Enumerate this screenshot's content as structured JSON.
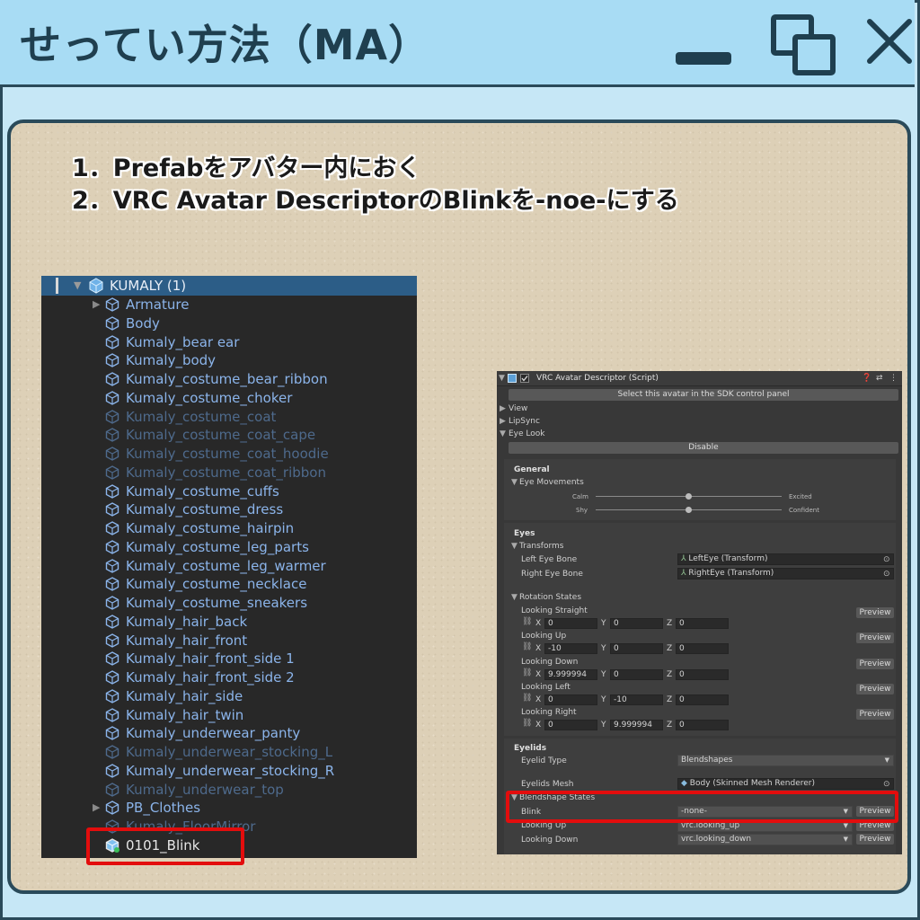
{
  "window": {
    "title": "せってい方法（MA）"
  },
  "steps": [
    "1．Prefabをアバター内におく",
    "2．VRC Avatar DescriptorのBlinkを-noe-にする"
  ],
  "hierarchy": {
    "root": "KUMALY (1)",
    "items": [
      {
        "label": "Armature",
        "state": "on",
        "arrow": true
      },
      {
        "label": "Body",
        "state": "on",
        "arrow": false
      },
      {
        "label": "Kumaly_bear ear",
        "state": "on",
        "arrow": false
      },
      {
        "label": "Kumaly_body",
        "state": "on",
        "arrow": false
      },
      {
        "label": "Kumaly_costume_bear_ribbon",
        "state": "on",
        "arrow": false
      },
      {
        "label": "Kumaly_costume_choker",
        "state": "on",
        "arrow": false
      },
      {
        "label": "Kumaly_costume_coat",
        "state": "off",
        "arrow": false
      },
      {
        "label": "Kumaly_costume_coat_cape",
        "state": "off",
        "arrow": false
      },
      {
        "label": "Kumaly_costume_coat_hoodie",
        "state": "off",
        "arrow": false
      },
      {
        "label": "Kumaly_costume_coat_ribbon",
        "state": "off",
        "arrow": false
      },
      {
        "label": "Kumaly_costume_cuffs",
        "state": "on",
        "arrow": false
      },
      {
        "label": "Kumaly_costume_dress",
        "state": "on",
        "arrow": false
      },
      {
        "label": "Kumaly_costume_hairpin",
        "state": "on",
        "arrow": false
      },
      {
        "label": "Kumaly_costume_leg_parts",
        "state": "on",
        "arrow": false
      },
      {
        "label": "Kumaly_costume_leg_warmer",
        "state": "on",
        "arrow": false
      },
      {
        "label": "Kumaly_costume_necklace",
        "state": "on",
        "arrow": false
      },
      {
        "label": "Kumaly_costume_sneakers",
        "state": "on",
        "arrow": false
      },
      {
        "label": "Kumaly_hair_back",
        "state": "on",
        "arrow": false
      },
      {
        "label": "Kumaly_hair_front",
        "state": "on",
        "arrow": false
      },
      {
        "label": "Kumaly_hair_front_side 1",
        "state": "on",
        "arrow": false
      },
      {
        "label": "Kumaly_hair_front_side 2",
        "state": "on",
        "arrow": false
      },
      {
        "label": "Kumaly_hair_side",
        "state": "on",
        "arrow": false
      },
      {
        "label": "Kumaly_hair_twin",
        "state": "on",
        "arrow": false
      },
      {
        "label": "Kumaly_underwear_panty",
        "state": "on",
        "arrow": false
      },
      {
        "label": "Kumaly_underwear_stocking_L",
        "state": "off",
        "arrow": false
      },
      {
        "label": "Kumaly_underwear_stocking_R",
        "state": "on",
        "arrow": false
      },
      {
        "label": "Kumaly_underwear_top",
        "state": "off",
        "arrow": false
      },
      {
        "label": "PB_Clothes",
        "state": "on",
        "arrow": true
      },
      {
        "label": "Kumaly_FloorMirror",
        "state": "off",
        "arrow": false
      },
      {
        "label": "0101_Blink",
        "state": "white",
        "arrow": false
      }
    ]
  },
  "inspector": {
    "header": "VRC Avatar Descriptor (Script)",
    "sdk_button": "Select this avatar in the SDK control panel",
    "fold_view": "View",
    "fold_lipsync": "LipSync",
    "fold_eyelook": "Eye Look",
    "disable_button": "Disable",
    "general": {
      "title": "General",
      "eye_movements": "Eye Movements",
      "calm": "Calm",
      "excited": "Excited",
      "shy": "Shy",
      "confident": "Confident",
      "calm_excited_value": 0.5,
      "shy_confident_value": 0.5
    },
    "eyes": {
      "title": "Eyes",
      "transforms": "Transforms",
      "left_label": "Left Eye Bone",
      "left_value": "LeftEye (Transform)",
      "right_label": "Right Eye Bone",
      "right_value": "RightEye (Transform)",
      "rotation_states": "Rotation States",
      "preview_label": "Preview",
      "axis_x": "X",
      "axis_y": "Y",
      "axis_z": "Z",
      "rotations": [
        {
          "label": "Looking Straight",
          "x": "0",
          "y": "0",
          "z": "0"
        },
        {
          "label": "Looking Up",
          "x": "-10",
          "y": "0",
          "z": "0"
        },
        {
          "label": "Looking Down",
          "x": "9.999994",
          "y": "0",
          "z": "0"
        },
        {
          "label": "Looking Left",
          "x": "0",
          "y": "-10",
          "z": "0"
        },
        {
          "label": "Looking Right",
          "x": "0",
          "y": "9.999994",
          "z": "0"
        }
      ]
    },
    "eyelids": {
      "title": "Eyelids",
      "type_label": "Eyelid Type",
      "type_value": "Blendshapes",
      "mesh_label": "Eyelids Mesh",
      "mesh_value": "Body (Skinned Mesh Renderer)",
      "states_title": "Blendshape States",
      "blink_label": "Blink",
      "blink_value": "-none-",
      "up_label": "Looking Up",
      "up_value": "vrc.looking_up",
      "down_label": "Looking Down",
      "down_value": "vrc.looking_down"
    }
  }
}
